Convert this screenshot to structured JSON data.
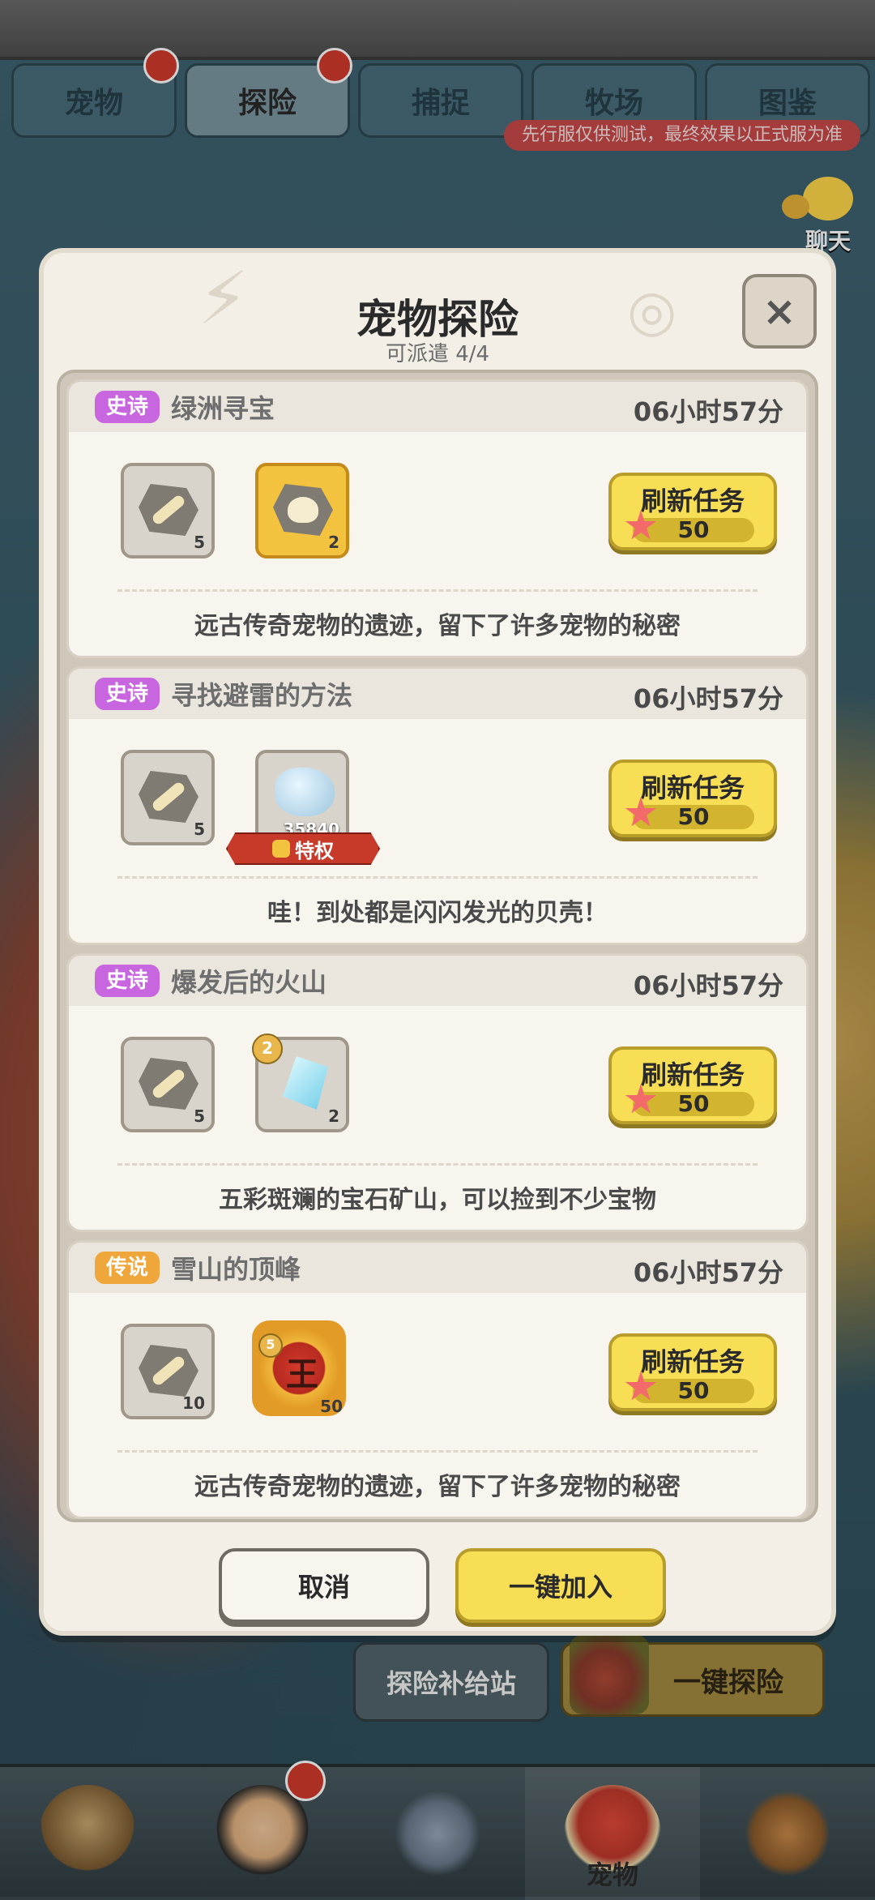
{
  "tabs": [
    {
      "label": "宠物",
      "active": false,
      "bell": true
    },
    {
      "label": "探险",
      "active": true,
      "bell": true
    },
    {
      "label": "捕捉",
      "active": false,
      "bell": false
    },
    {
      "label": "牧场",
      "active": false,
      "bell": false
    },
    {
      "label": "图鉴",
      "active": false,
      "bell": false
    }
  ],
  "test_banner": "先行服仅供测试，最终效果以正式服为准",
  "chat": {
    "label": "聊天",
    "icon": "chat-bubble-icon"
  },
  "dialog": {
    "title": "宠物探险",
    "subtitle": "可派遣 4/4",
    "close_icon": "close-icon",
    "tasks": [
      {
        "rarity": "史诗",
        "rarity_type": "epic",
        "name": "绿洲寻宝",
        "time": "06小时57分",
        "rewards": [
          {
            "icon": "bone-stone-icon",
            "count": "5"
          },
          {
            "icon": "skull-stone-icon",
            "count": "2",
            "gold": true
          }
        ],
        "refresh_label": "刷新任务",
        "refresh_cost": "50",
        "description": "远古传奇宠物的遗迹，留下了许多宠物的秘密"
      },
      {
        "rarity": "史诗",
        "rarity_type": "epic",
        "name": "寻找避雷的方法",
        "time": "06小时57分",
        "rewards": [
          {
            "icon": "bone-stone-icon",
            "count": "5"
          },
          {
            "icon": "shell-icon",
            "count": "35840",
            "privilege": "特权"
          }
        ],
        "refresh_label": "刷新任务",
        "refresh_cost": "50",
        "description": "哇！到处都是闪闪发光的贝壳！"
      },
      {
        "rarity": "史诗",
        "rarity_type": "epic",
        "name": "爆发后的火山",
        "time": "06小时57分",
        "rewards": [
          {
            "icon": "bone-stone-icon",
            "count": "5"
          },
          {
            "icon": "crystal-icon",
            "count": "2",
            "level": "2"
          }
        ],
        "refresh_label": "刷新任务",
        "refresh_cost": "50",
        "description": "五彩斑斓的宝石矿山，可以捡到不少宝物"
      },
      {
        "rarity": "传说",
        "rarity_type": "legend",
        "name": "雪山的顶峰",
        "time": "06小时57分",
        "rewards": [
          {
            "icon": "bone-stone-icon",
            "count": "10"
          },
          {
            "icon": "medal-icon",
            "count": "50",
            "level": "5"
          }
        ],
        "refresh_label": "刷新任务",
        "refresh_cost": "50",
        "description": "远古传奇宠物的遗迹，留下了许多宠物的秘密"
      }
    ],
    "cancel_label": "取消",
    "join_all_label": "一键加入"
  },
  "bottom_actions": {
    "supply_label": "探险补给站",
    "explore_all_label": "一键探险"
  },
  "bottom_nav": [
    {
      "icon": "caveman-avatar-icon",
      "label": ""
    },
    {
      "icon": "hero-avatar-icon",
      "label": "",
      "bell": true
    },
    {
      "icon": "weapon-icon",
      "label": ""
    },
    {
      "icon": "pet-dino-icon",
      "label": "宠物",
      "active": true
    },
    {
      "icon": "totem-icon",
      "label": ""
    }
  ]
}
